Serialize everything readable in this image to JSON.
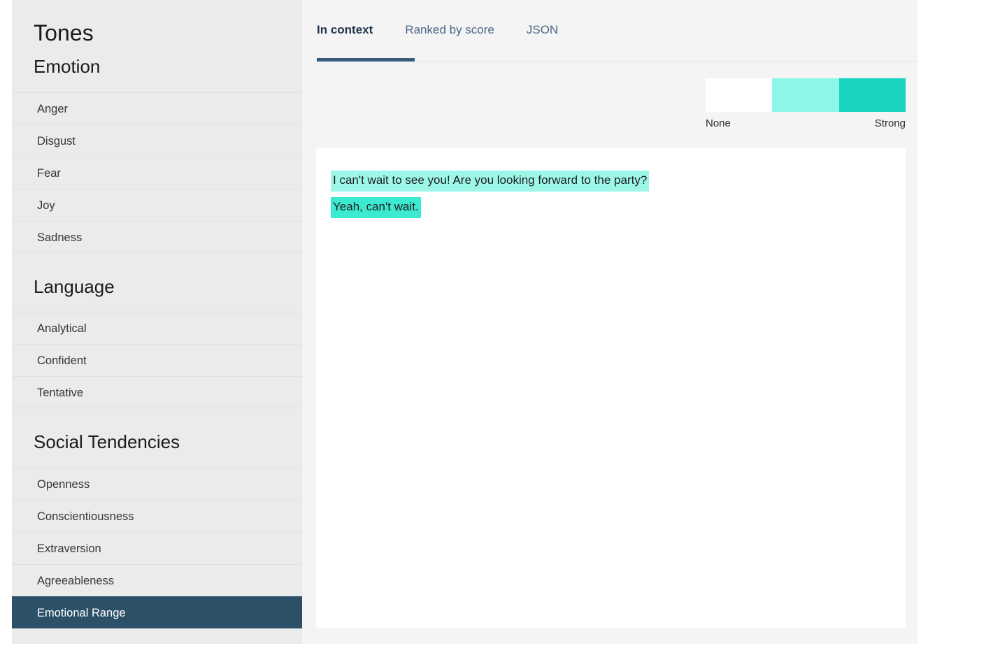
{
  "sidebar": {
    "title": "Tones",
    "sections": [
      {
        "heading": "Emotion",
        "items": [
          {
            "label": "Anger",
            "selected": false
          },
          {
            "label": "Disgust",
            "selected": false
          },
          {
            "label": "Fear",
            "selected": false
          },
          {
            "label": "Joy",
            "selected": false
          },
          {
            "label": "Sadness",
            "selected": false
          }
        ]
      },
      {
        "heading": "Language",
        "items": [
          {
            "label": "Analytical",
            "selected": false
          },
          {
            "label": "Confident",
            "selected": false
          },
          {
            "label": "Tentative",
            "selected": false
          }
        ]
      },
      {
        "heading": "Social Tendencies",
        "items": [
          {
            "label": "Openness",
            "selected": false
          },
          {
            "label": "Conscientiousness",
            "selected": false
          },
          {
            "label": "Extraversion",
            "selected": false
          },
          {
            "label": "Agreeableness",
            "selected": false
          },
          {
            "label": "Emotional Range",
            "selected": true
          }
        ]
      }
    ]
  },
  "tabs": [
    {
      "label": "In context",
      "active": true
    },
    {
      "label": "Ranked by score",
      "active": false
    },
    {
      "label": "JSON",
      "active": false
    }
  ],
  "legend": {
    "low_label": "None",
    "high_label": "Strong",
    "swatches": [
      "#ffffff",
      "#8df6e7",
      "#17d3bf"
    ]
  },
  "content": {
    "sentences": [
      {
        "text": "I can't wait to see you! Are you looking forward to the party?",
        "highlight": "#9cf7e8"
      },
      {
        "text": "Yeah, can't wait.",
        "highlight": "#3ce9d1"
      }
    ]
  },
  "colors": {
    "sidebar_bg": "#ebebeb",
    "selected_bg": "#2b5068",
    "main_bg": "#f4f4f4",
    "card_bg": "#ffffff",
    "tab_active_underline": "#3a5a7d"
  }
}
